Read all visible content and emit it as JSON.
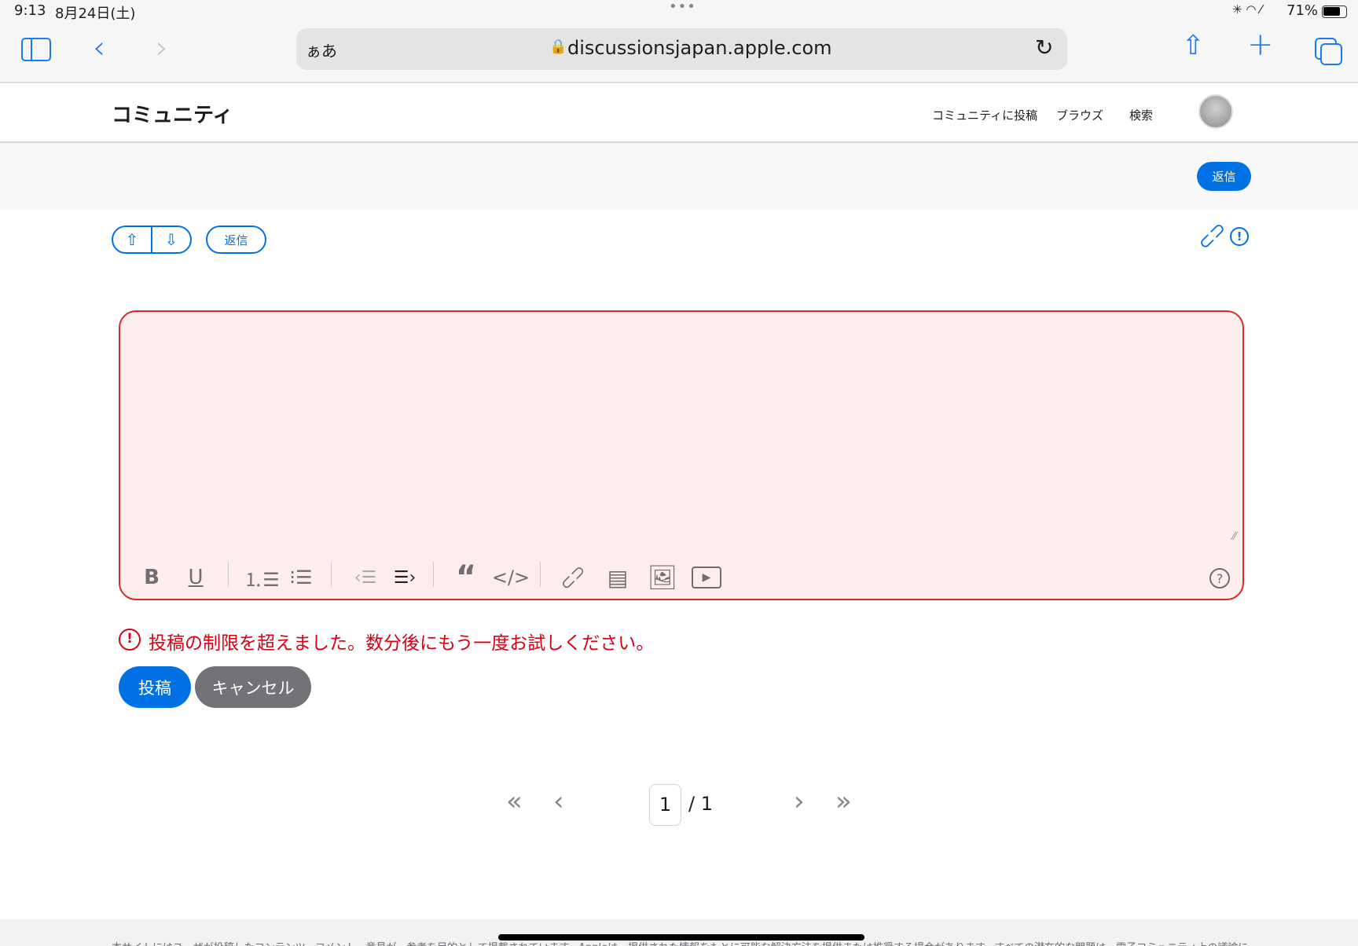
{
  "status_bar": {
    "time": "9:13",
    "date": "8月24日(土)",
    "battery": "71%"
  },
  "browser": {
    "text_size_label": "ぁあ",
    "url": "discussionsjapan.apple.com"
  },
  "site_header": {
    "title": "コミュニティ",
    "nav": [
      "コミュニティに投稿",
      "ブラウズ",
      "検索"
    ]
  },
  "band": {
    "reply_label": "返信"
  },
  "post_actions": {
    "reply_label": "返信"
  },
  "editor": {
    "value": "",
    "toolbar": [
      "bold",
      "underline",
      "ordered-list",
      "unordered-list",
      "outdent",
      "indent",
      "quote",
      "code",
      "link",
      "document",
      "image",
      "video",
      "help"
    ]
  },
  "error": {
    "message": "投稿の制限を超えました。数分後にもう一度お試しください。",
    "color": "#d70015"
  },
  "form_buttons": {
    "submit_label": "投稿",
    "cancel_label": "キャンセル"
  },
  "pagination": {
    "current_page": "1",
    "total_label": "/ 1"
  },
  "footer": {
    "text": "本サイトにはユーザが投稿したコンテンツ、コメント、意見が、参考を目的として掲載されています。Appleは、提供された情報をもとに可能な解決方法を提供または推奨する場合があります。すべての潜在的な問題は、電子コミュニティ上の議論に"
  }
}
